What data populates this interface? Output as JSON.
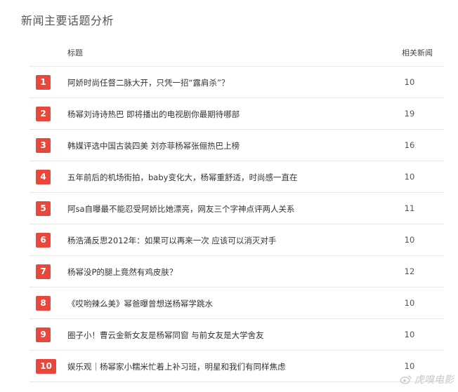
{
  "page_title": "新闻主要话题分析",
  "table": {
    "header_title": "标题",
    "header_count": "相关新闻",
    "rows": [
      {
        "rank": "1",
        "title": "阿娇时尚任督二脉大开，只凭一招“露肩杀”？",
        "count": "10"
      },
      {
        "rank": "2",
        "title": "杨幂刘诗诗热巴 即将播出的电视剧你最期待哪部",
        "count": "19"
      },
      {
        "rank": "3",
        "title": "韩媒评选中国古装四美 刘亦菲杨幂张俪热巴上榜",
        "count": "16"
      },
      {
        "rank": "4",
        "title": "五年前后的机场街拍，baby变化大，杨幂重舒适，时尚感一直在",
        "count": "10"
      },
      {
        "rank": "5",
        "title": "阿sa自曝最不能忍受阿娇比她漂亮，网友三个字神点评两人关系",
        "count": "11"
      },
      {
        "rank": "6",
        "title": "杨浩涌反思2012年：如果可以再来一次 应该可以消灭对手",
        "count": "10"
      },
      {
        "rank": "7",
        "title": "杨幂没P的腿上竟然有鸡皮肤？",
        "count": "12"
      },
      {
        "rank": "8",
        "title": "《哎哟辣么美》幂爸曝曾想送杨幂学跳水",
        "count": "10"
      },
      {
        "rank": "9",
        "title": "圈子小！曹云金新女友是杨幂同窗 与前女友是大学舍友",
        "count": "10"
      },
      {
        "rank": "10",
        "title": "娱乐观｜杨幂家小糯米忙着上补习班，明星和我们有同样焦虑",
        "count": "10"
      }
    ]
  },
  "watermark": "虎嗅电影",
  "colors": {
    "rank_badge": "#e8473c"
  },
  "icons": {
    "watermark": "weibo-icon"
  }
}
